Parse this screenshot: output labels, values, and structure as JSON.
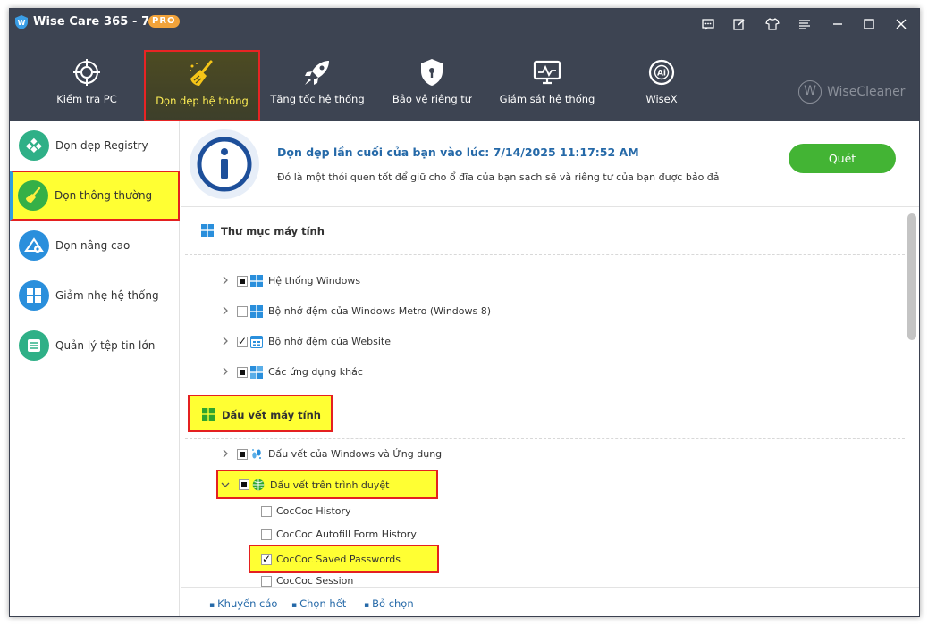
{
  "titlebar": {
    "app_title": "Wise Care 365 - 7.2.6",
    "badge": "PRO"
  },
  "nav": [
    {
      "label": "Kiểm tra PC",
      "icon": "crosshair-icon"
    },
    {
      "label": "Dọn dẹp hệ thống",
      "icon": "broom-icon"
    },
    {
      "label": "Tăng tốc hệ thống",
      "icon": "rocket-icon"
    },
    {
      "label": "Bảo vệ riêng tư",
      "icon": "shield-lock-icon"
    },
    {
      "label": "Giám sát hệ thống",
      "icon": "monitor-icon"
    },
    {
      "label": "WiseX",
      "icon": "ai-icon"
    }
  ],
  "brand": {
    "text": "WiseCleaner",
    "mark": "W"
  },
  "sidebar": [
    {
      "label": "Dọn dẹp Registry",
      "icon": "registry-icon"
    },
    {
      "label": "Dọn thông thường",
      "icon": "broom-icon"
    },
    {
      "label": "Dọn nâng cao",
      "icon": "advanced-clean-icon"
    },
    {
      "label": "Giảm nhẹ hệ thống",
      "icon": "windows-icon"
    },
    {
      "label": "Quản lý tệp tin lớn",
      "icon": "file-list-icon"
    }
  ],
  "info": {
    "title": "Dọn dẹp lần cuối của bạn vào lúc: 7/14/2025 11:17:52 AM",
    "desc": "Đó là một thói quen tốt để giữ cho ổ đĩa của bạn sạch sẽ và riêng tư của bạn được bảo đả",
    "scan_label": "Quét"
  },
  "sections": [
    {
      "title": "Thư mục máy tính",
      "items": [
        {
          "label": "Hệ thống Windows",
          "state": "partial"
        },
        {
          "label": "Bộ nhớ đệm của Windows Metro (Windows 8)",
          "state": "unchecked"
        },
        {
          "label": "Bộ nhớ đệm của Website",
          "state": "checked"
        },
        {
          "label": "Các ứng dụng khác",
          "state": "partial"
        }
      ]
    },
    {
      "title": "Dấu vết máy tính",
      "items": [
        {
          "label": "Dấu vết của Windows và Ứng dụng",
          "state": "partial"
        },
        {
          "label": "Dấu vết trên trình duyệt",
          "state": "partial"
        }
      ],
      "subitems": [
        {
          "label": "CocCoc History",
          "state": "unchecked"
        },
        {
          "label": "CocCoc Autofill Form History",
          "state": "unchecked"
        },
        {
          "label": "CocCoc Saved Passwords",
          "state": "checked"
        },
        {
          "label": "CocCoc Session",
          "state": "unchecked"
        }
      ]
    }
  ],
  "footer": {
    "recommend": "Khuyến cáo",
    "select_all": "Chọn hết",
    "deselect": "Bỏ chọn"
  }
}
